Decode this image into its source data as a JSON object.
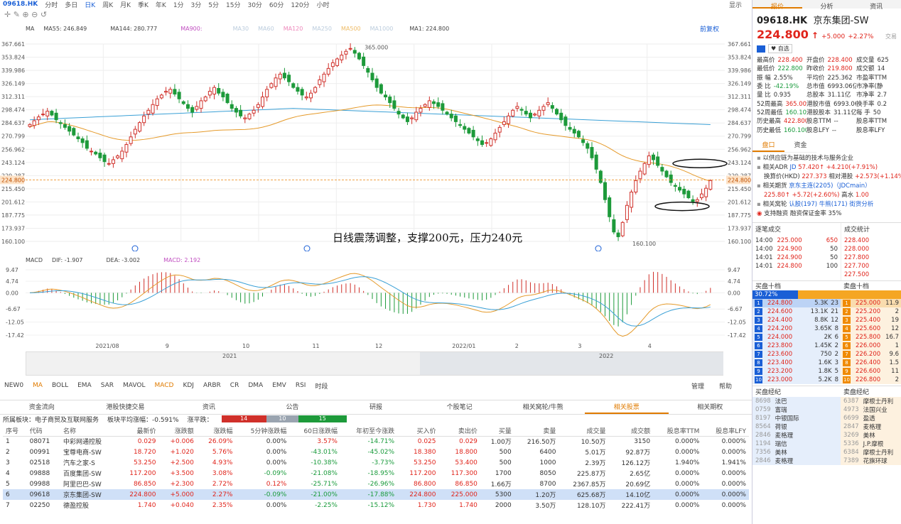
{
  "toolbar": {
    "symbol": "09618.HK",
    "periods": [
      "分时",
      "多日",
      "日K",
      "周K",
      "月K",
      "季K",
      "年K",
      "1分",
      "3分",
      "5分",
      "15分",
      "30分",
      "60分",
      "120分",
      "小时"
    ],
    "active": "日K",
    "right": "显示"
  },
  "ma_legend": {
    "label": "MA",
    "ma55": "MA55: 246.849",
    "ma144": "MA144: 280.777",
    "ma900": "MA900:",
    "ma30": "MA30",
    "ma60": "MA60",
    "ma120": "MA120",
    "ma250": "MA250",
    "ma500": "MA500",
    "ma1000": "MA1000",
    "ma1": "MA1: 224.800",
    "restore": "前复权"
  },
  "price_axis": [
    "367.661",
    "353.824",
    "339.986",
    "326.149",
    "312.311",
    "298.474",
    "284.637",
    "270.799",
    "256.962",
    "243.124",
    "229.287",
    "215.450",
    "201.612",
    "187.775",
    "173.937",
    "160.100"
  ],
  "current_price": "224.800",
  "high_label": "365.000",
  "low_label": "160.100",
  "annotation": "日线震荡调整，支撑200元，压力240元",
  "macd_legend": {
    "label": "MACD",
    "dif": "DIF: -1.907",
    "dea": "DEA: -3.002",
    "macd": "MACD: 2.192"
  },
  "macd_axis": [
    "9.47",
    "4.74",
    "0.00",
    "-6.67",
    "-12.05",
    "-17.42"
  ],
  "date_axis": [
    "2021/08",
    "9",
    "10",
    "11",
    "12",
    "2022/01",
    "2",
    "3",
    "4"
  ],
  "overview_years": [
    "2021",
    "2022"
  ],
  "indicators": [
    "NEW0",
    "MA",
    "BOLL",
    "EMA",
    "SAR",
    "MAVOL",
    "MACD",
    "KDJ",
    "ARBR",
    "CR",
    "DMA",
    "EMV",
    "RSI",
    "时段"
  ],
  "ind_right": [
    "管理",
    "帮助"
  ],
  "bottom_tabs": [
    "资金流向",
    "港股快捷交易",
    "资讯",
    "公告",
    "研报",
    "个股笔记",
    "相关窝轮/牛熊",
    "相关股票",
    "相关期权"
  ],
  "bottom_active": "相关股票",
  "sector": {
    "label": "所属板块：电子商贸及互联网服务",
    "avg": "板块平均涨幅：-0.591%",
    "dist": "涨平跌：",
    "up": "14",
    "flat": "10",
    "down": "15"
  },
  "table": {
    "headers": [
      "序号",
      "代码",
      "名称",
      "最新价",
      "涨跌额",
      "涨跌幅",
      "5分钟涨跌幅",
      "60日涨跌幅",
      "年初至今涨跌",
      "买入价",
      "卖出价",
      "买量",
      "卖量",
      "成交量",
      "成交额",
      "股息率TTM",
      "股息率LFY"
    ],
    "rows": [
      [
        "1",
        "08071",
        "中彩网通控股",
        "0.029",
        "+0.006",
        "26.09%",
        "0.00%",
        "3.57%",
        "-14.71%",
        "0.025",
        "0.029",
        "1.00万",
        "216.50万",
        "10.50万",
        "3150",
        "0.000%",
        "0.000%"
      ],
      [
        "2",
        "00991",
        "宝尊电商-SW",
        "18.720",
        "+1.020",
        "5.76%",
        "0.00%",
        "-43.01%",
        "-45.02%",
        "18.380",
        "18.800",
        "500",
        "6400",
        "5.01万",
        "92.87万",
        "0.000%",
        "0.000%"
      ],
      [
        "3",
        "02518",
        "汽车之家-S",
        "53.250",
        "+2.500",
        "4.93%",
        "0.00%",
        "-10.38%",
        "-3.73%",
        "53.250",
        "53.400",
        "500",
        "1000",
        "2.39万",
        "126.12万",
        "1.940%",
        "1.941%"
      ],
      [
        "4",
        "09888",
        "百度集团-SW",
        "117.200",
        "+3.500",
        "3.08%",
        "-0.09%",
        "-21.08%",
        "-18.95%",
        "117.200",
        "117.300",
        "1700",
        "8050",
        "225.87万",
        "2.65亿",
        "0.000%",
        "0.000%"
      ],
      [
        "5",
        "09988",
        "阿里巴巴-SW",
        "86.850",
        "+2.300",
        "2.72%",
        "0.12%",
        "-25.71%",
        "-26.96%",
        "86.800",
        "86.850",
        "1.66万",
        "8700",
        "2367.85万",
        "20.69亿",
        "0.000%",
        "0.000%"
      ],
      [
        "6",
        "09618",
        "京东集团-SW",
        "224.800",
        "+5.000",
        "2.27%",
        "-0.09%",
        "-21.00%",
        "-17.88%",
        "224.800",
        "225.000",
        "5300",
        "1.20万",
        "625.68万",
        "14.10亿",
        "0.000%",
        "0.000%"
      ],
      [
        "7",
        "02250",
        "德盈控股",
        "1.740",
        "+0.040",
        "2.35%",
        "0.00%",
        "-2.25%",
        "-15.12%",
        "1.730",
        "1.740",
        "2000",
        "3.50万",
        "128.10万",
        "222.41万",
        "0.000%",
        "0.000%"
      ]
    ]
  },
  "right": {
    "tabs": [
      "报价",
      "分析",
      "资讯"
    ],
    "code": "09618.HK",
    "name": "京东集团-SW",
    "price": "224.800",
    "change": "+5.000",
    "pct": "+2.27%",
    "trade_btn": "交易",
    "watch": "自选",
    "stats": [
      [
        "最高价",
        "228.400",
        "开盘价",
        "228.400",
        "成交量",
        "625"
      ],
      [
        "最低价",
        "222.800",
        "昨收价",
        "219.800",
        "成交额",
        "14"
      ],
      [
        "振 幅",
        "2.55%",
        "平均价",
        "225.362",
        "市盈率TTM",
        ""
      ],
      [
        "委 比",
        "-42.19%",
        "总市值",
        "6993.06亿",
        "市净率(静",
        ""
      ],
      [
        "量 比",
        "0.935",
        "总股本",
        "31.11亿",
        "市净率",
        "2.7"
      ],
      [
        "52周最高",
        "365.000",
        "港股市值",
        "6993.06亿",
        "换手率",
        "0.2"
      ],
      [
        "52周最低",
        "160.100",
        "港股股本",
        "31.11亿",
        "每 手",
        "50"
      ],
      [
        "历史最高",
        "422.800",
        "股息TTM",
        "--",
        "股息率TTM",
        ""
      ],
      [
        "历史最低",
        "160.100",
        "股息LFY",
        "--",
        "股息率LFY",
        ""
      ]
    ],
    "subtabs": [
      "盘口",
      "资金"
    ],
    "info1": "以供应链为基础的技术与服务企业",
    "adr": {
      "label": "相关ADR",
      "code": "JD",
      "price": "57.420",
      "chg": "+4.210(+7.91%)"
    },
    "conv": {
      "label": "换算价(HKD)",
      "val": "227.373",
      "vs": "相对港股",
      "chg": "+2.573(+1.14%)"
    },
    "rel": {
      "label": "相关期货",
      "name": "京东主连(2205)（JDCmain）",
      "price": "225.80",
      "chg": "+5.72(+2.60%)",
      "hold_label": "高水",
      "hold": "1.00"
    },
    "warrants": {
      "label": "相关窝轮",
      "c": "认股(197)",
      "b": "牛熊(171)",
      "a": "街货分析"
    },
    "margin": {
      "label": "支持融资",
      "v": "融资保证金率 35%"
    },
    "ticks_title": "逐笔成交",
    "ticks": [
      [
        "14:00",
        "225.000",
        "650"
      ],
      [
        "14:00",
        "224.900",
        "50"
      ],
      [
        "14:01",
        "224.900",
        "50"
      ],
      [
        "14:01",
        "224.800",
        "100"
      ]
    ],
    "tick_top": [
      "",
      "",
      "50"
    ],
    "stat_title": "成交统计",
    "stat_prices": [
      "228.400",
      "228.000",
      "227.800",
      "227.700",
      "227.500"
    ],
    "bid_title": "买盘十档",
    "ask_title": "卖盘十档",
    "bid_pct": "30.72%",
    "bids": [
      [
        "1",
        "224.800",
        "5.3K",
        "23"
      ],
      [
        "2",
        "224.600",
        "13.1K",
        "21"
      ],
      [
        "3",
        "224.400",
        "8.8K",
        "12"
      ],
      [
        "4",
        "224.200",
        "3.65K",
        "8"
      ],
      [
        "5",
        "224.000",
        "2K",
        "6"
      ],
      [
        "6",
        "223.800",
        "1.45K",
        "2"
      ],
      [
        "7",
        "223.600",
        "750",
        "2"
      ],
      [
        "8",
        "223.400",
        "1.6K",
        "3"
      ],
      [
        "9",
        "223.200",
        "1.8K",
        "5"
      ],
      [
        "10",
        "223.000",
        "5.2K",
        "8"
      ]
    ],
    "asks": [
      [
        "1",
        "225.000",
        "11.9"
      ],
      [
        "2",
        "225.200",
        "2"
      ],
      [
        "3",
        "225.400",
        "19"
      ],
      [
        "4",
        "225.600",
        "12"
      ],
      [
        "5",
        "225.800",
        "16.7"
      ],
      [
        "6",
        "226.000",
        "1"
      ],
      [
        "7",
        "226.200",
        "9.6"
      ],
      [
        "8",
        "226.400",
        "1.5"
      ],
      [
        "9",
        "226.600",
        "11"
      ],
      [
        "10",
        "226.800",
        "2"
      ]
    ],
    "broker_buy_title": "买盘经纪",
    "broker_sell_title": "卖盘经纪",
    "buy_brokers": [
      [
        "8698",
        "法巴"
      ],
      [
        "0759",
        "富瑞"
      ],
      [
        "8197",
        "中银国际"
      ],
      [
        "8564",
        "荷银"
      ],
      [
        "2846",
        "麦格理"
      ],
      [
        "1194",
        "瑞信"
      ],
      [
        "7356",
        "美林"
      ],
      [
        "2846",
        "麦格理"
      ]
    ],
    "sell_brokers": [
      [
        "6387",
        "摩根士丹利"
      ],
      [
        "4973",
        "法国兴业"
      ],
      [
        "6699",
        "盈透"
      ],
      [
        "2847",
        "麦格理"
      ],
      [
        "3269",
        "美林"
      ],
      [
        "5336",
        "J.P.摩根"
      ],
      [
        "6384",
        "摩根士丹利"
      ],
      [
        "7389",
        "花旗环球"
      ]
    ]
  },
  "chart_data": {
    "type": "candlestick",
    "title": "",
    "ylim": [
      160.1,
      367.661
    ],
    "current": 224.8,
    "high": 365.0,
    "low": 160.1,
    "closes": [
      283,
      287,
      291,
      294,
      297,
      293,
      288,
      284,
      280,
      276,
      272,
      268,
      264,
      258,
      255,
      252,
      248,
      244,
      242,
      246,
      250,
      255,
      262,
      270,
      278,
      285,
      292,
      298,
      304,
      310,
      314,
      318,
      320,
      315,
      310,
      305,
      300,
      296,
      302,
      308,
      312,
      318,
      322,
      316,
      312,
      306,
      300,
      296,
      292,
      290,
      294,
      298,
      304,
      312,
      320,
      326,
      332,
      336,
      332,
      328,
      322,
      318,
      314,
      312,
      316,
      322,
      330,
      336,
      342,
      348,
      352,
      356,
      360,
      363,
      358,
      352,
      345,
      338,
      330,
      322,
      316,
      312,
      306,
      300,
      294,
      290,
      286,
      290,
      296,
      300,
      304,
      308,
      305,
      302,
      298,
      294,
      290,
      286,
      282,
      278,
      274,
      270,
      266,
      262,
      264,
      268,
      274,
      280,
      286,
      292,
      298,
      302,
      298,
      294,
      290,
      294,
      298,
      302,
      306,
      300,
      294,
      288,
      282,
      278,
      274,
      270,
      264,
      258,
      248,
      236,
      222,
      204,
      186,
      170,
      165,
      180,
      198,
      212,
      224,
      234,
      242,
      250,
      246,
      240,
      234,
      228,
      222,
      218,
      214,
      210,
      206,
      202,
      204,
      210,
      216,
      224
    ]
  }
}
